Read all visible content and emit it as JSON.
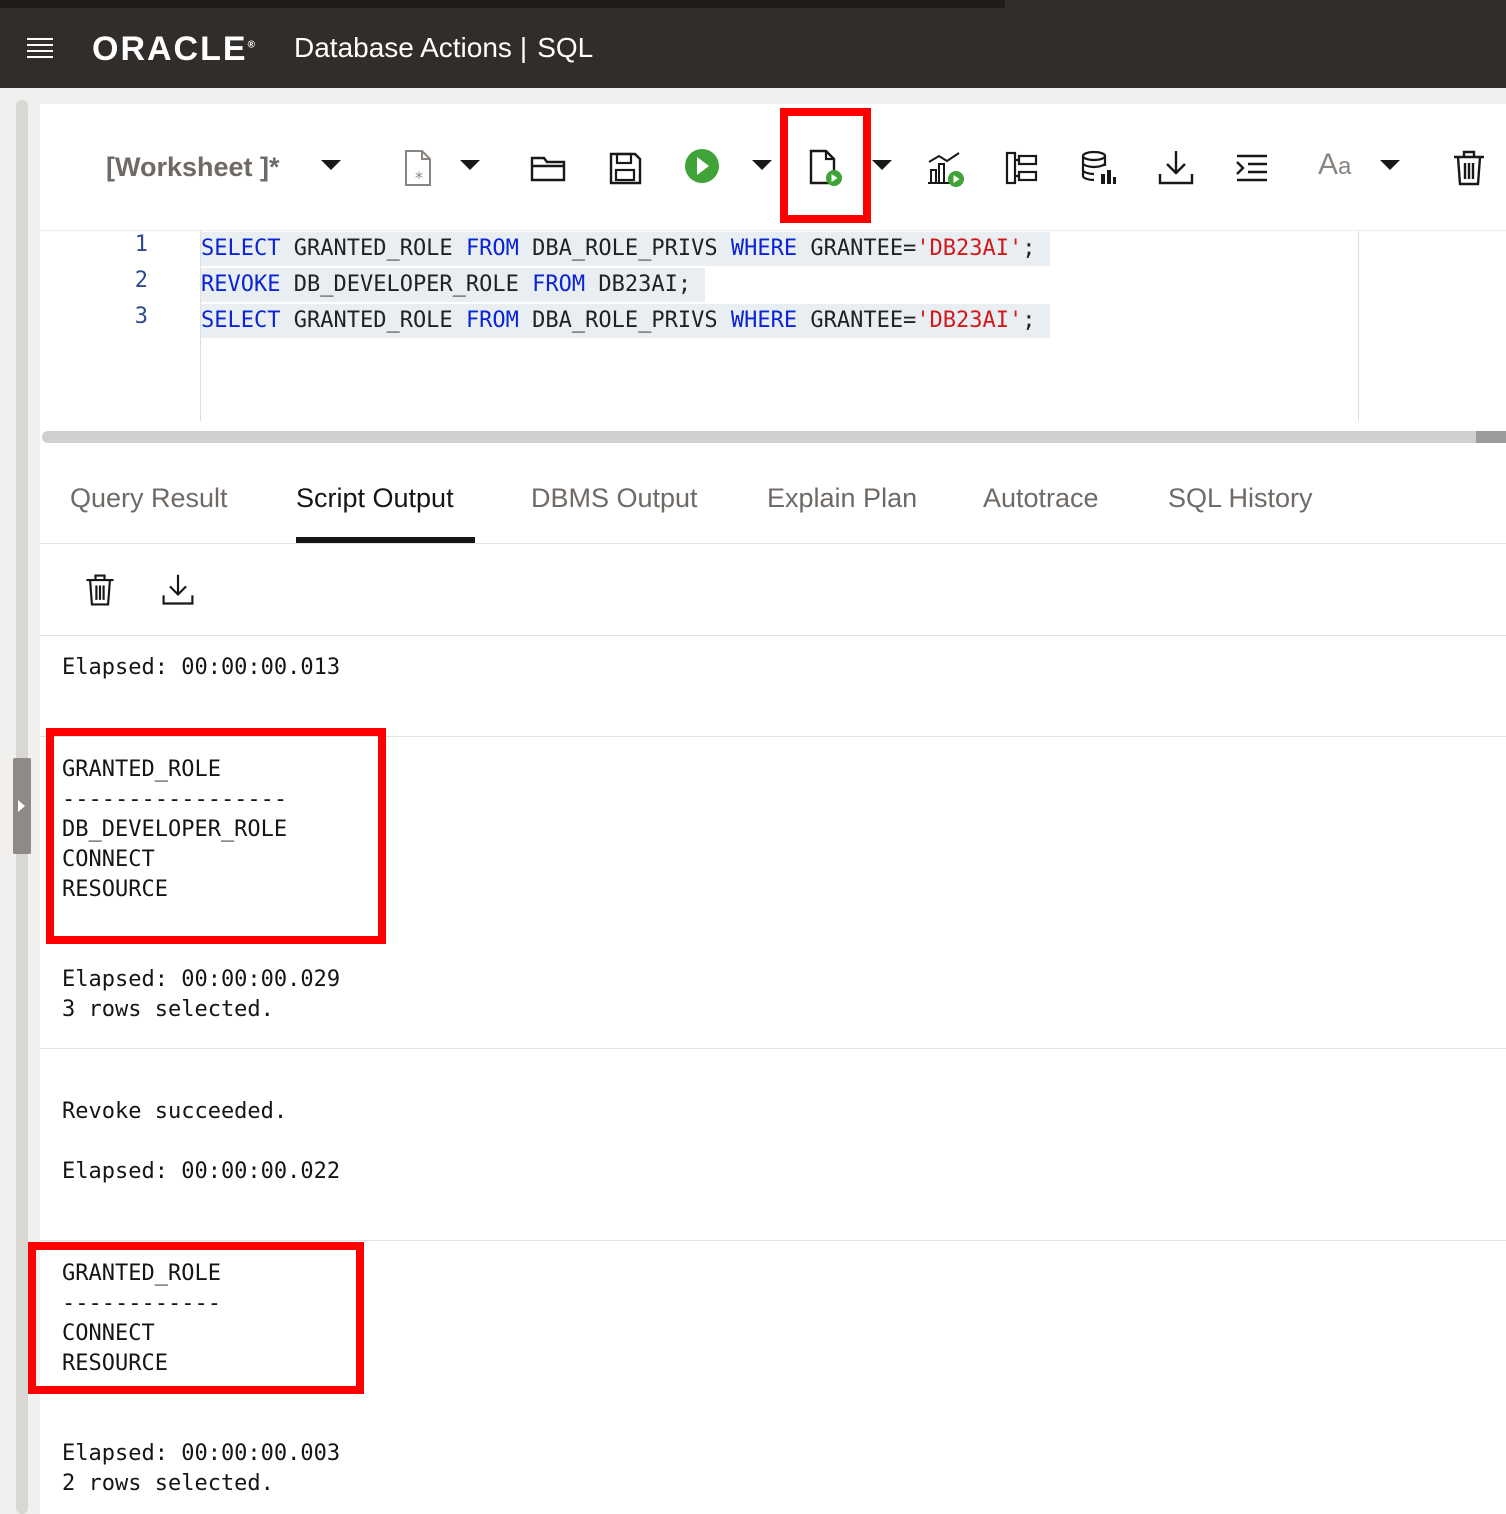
{
  "header": {
    "logo_text": "ORACLE",
    "app_name": "Database Actions",
    "section": "SQL",
    "separator": "|"
  },
  "toolbar": {
    "worksheet_title": "[Worksheet ]*"
  },
  "editor": {
    "lines": [
      {
        "number": "1",
        "kw1": "SELECT",
        "t1": "GRANTED_ROLE",
        "kw2": "FROM",
        "t2": "DBA_ROLE_PRIVS",
        "kw3": "WHERE",
        "t3": "GRANTEE=",
        "str": "'DB23AI'",
        "end": ";"
      },
      {
        "number": "2",
        "kw1": "REVOKE",
        "t1": "DB_DEVELOPER_ROLE",
        "kw2": "FROM",
        "t2": "DB23AI;"
      },
      {
        "number": "3",
        "kw1": "SELECT",
        "t1": "GRANTED_ROLE",
        "kw2": "FROM",
        "t2": "DBA_ROLE_PRIVS",
        "kw3": "WHERE",
        "t3": "GRANTEE=",
        "str": "'DB23AI'",
        "end": ";"
      }
    ]
  },
  "tabs": [
    "Query Result",
    "Script Output",
    "DBMS Output",
    "Explain Plan",
    "Autotrace",
    "SQL History"
  ],
  "output": {
    "elapsed_1": "Elapsed: 00:00:00.013",
    "result_1": {
      "header": "GRANTED_ROLE",
      "dashes": "-----------------",
      "rows": [
        "DB_DEVELOPER_ROLE",
        "CONNECT",
        "RESOURCE"
      ]
    },
    "elapsed_2": "Elapsed: 00:00:00.029",
    "rows_selected_2": "3 rows selected.",
    "revoke_msg": "Revoke succeeded.",
    "elapsed_3": "Elapsed: 00:00:00.022",
    "result_2": {
      "header": "GRANTED_ROLE",
      "dashes": "------------",
      "rows": [
        "CONNECT",
        "RESOURCE"
      ]
    },
    "elapsed_4": "Elapsed: 00:00:00.003",
    "rows_selected_4": "2 rows selected."
  },
  "colors": {
    "header_bg": "#312d2a",
    "keyword": "#0b24d6",
    "string": "#d11a1a",
    "highlight": "#ff0000",
    "run_green": "#3fa337"
  },
  "icons": [
    "menu-icon",
    "new-file-icon",
    "open-folder-icon",
    "save-icon",
    "run-statement-icon",
    "run-script-icon",
    "autotrace-icon",
    "explain-plan-icon",
    "sql-tuning-icon",
    "download-icon",
    "format-icon",
    "font-case-icon",
    "trash-icon"
  ]
}
